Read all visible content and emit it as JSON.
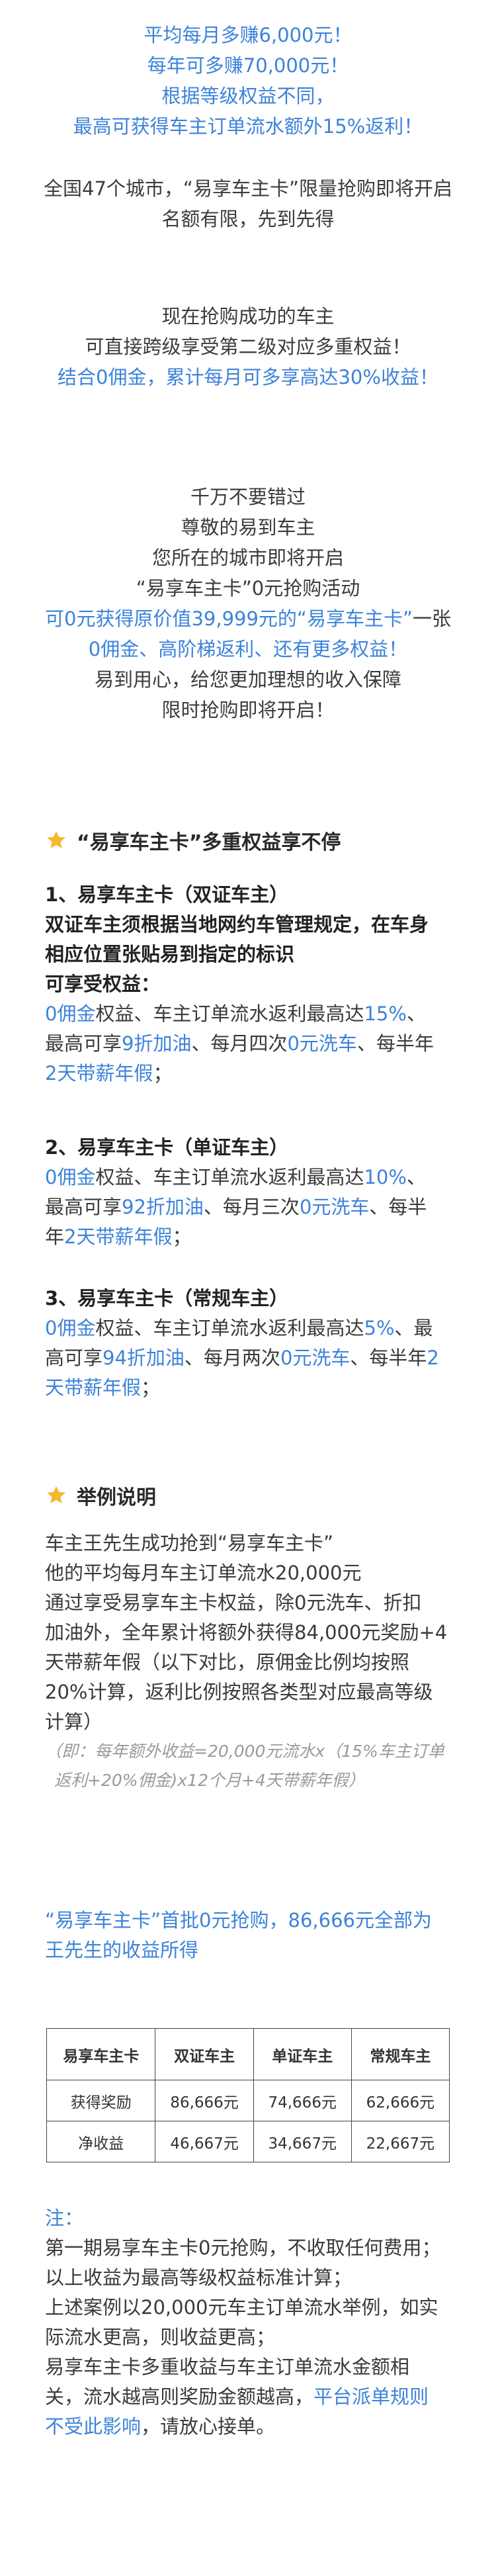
{
  "intro": {
    "lines": [
      "平均每月多赚6,000元！",
      "每年可多赚70,000元！",
      "根据等级权益不同，",
      "最高可获得车主订单流水额外15%返利！"
    ],
    "cities_line1": "全国47个城市，“易享车主卡”限量抢购即将开启",
    "cities_line2": "名额有限，先到先得"
  },
  "upgrade": {
    "line1": "现在抢购成功的车主",
    "line2": "可直接跨级享受第二级对应多重权益！",
    "line3": "结合0佣金，累计每月可多享高达30%收益！"
  },
  "invite": {
    "line1": "千万不要错过",
    "line2": "尊敬的易到车主",
    "line3": "您所在的城市即将开启",
    "line4": "“易享车主卡”0元抢购活动",
    "line5a": "可0元获得原价值39,999元的“易享车主卡”",
    "line5b": "一张",
    "line6": "0佣金、高阶梯返利、还有更多权益！",
    "line7": "易到用心，给您更加理想的收入保障",
    "line8": "限时抢购即将开启！"
  },
  "benefits": {
    "title": "“易享车主卡”多重权益享不停",
    "card1_title": "1、易享车主卡（双证车主）",
    "card1_rule1": "双证车主须根据当地网约车管理规定，在车身",
    "card1_rule2": "相应位置张贴易到指定的标识",
    "card1_enjoy": "可享受权益：",
    "card1_l1a": "0佣金",
    "card1_l1b": "权益、车主订单流水返利最高达",
    "card1_l1c": "15%",
    "card1_l1d": "、",
    "card1_l2a": "最高可享",
    "card1_l2b": "9折加油",
    "card1_l2c": "、每月四次",
    "card1_l2d": "0元洗车",
    "card1_l2e": "、每半年",
    "card1_l3a": "2天带薪年假",
    "card1_l3b": "；",
    "card2_title": "2、易享车主卡（单证车主）",
    "card2_l1a": "0佣金",
    "card2_l1b": "权益、车主订单流水返利最高达",
    "card2_l1c": "10%",
    "card2_l1d": "、",
    "card2_l2a": "最高可享",
    "card2_l2b": "92折加油",
    "card2_l2c": "、每月三次",
    "card2_l2d": "0元洗车",
    "card2_l2e": "、每半",
    "card2_l3a": "年",
    "card2_l3b": "2天带薪年假",
    "card2_l3c": "；",
    "card3_title": "3、易享车主卡（常规车主）",
    "card3_l1a": "0佣金",
    "card3_l1b": "权益、车主订单流水返利最高达",
    "card3_l1c": "5%",
    "card3_l1d": "、最",
    "card3_l2a": "高可享",
    "card3_l2b": "94折加油",
    "card3_l2c": "、每月两次",
    "card3_l2d": "0元洗车",
    "card3_l2e": "、每半年",
    "card3_l2f": "2",
    "card3_l3a": "天带薪年假",
    "card3_l3b": "；"
  },
  "example": {
    "title": "举例说明",
    "l1": "车主王先生成功抢到“易享车主卡”",
    "l2": "他的平均每月车主订单流水20,000元",
    "l3": "通过享受易享车主卡权益，除0元洗车、折扣",
    "l4": "加油外，全年累计将额外获得84,000元奖励+4",
    "l5": "天带薪年假（以下对比，原佣金比例均按照",
    "l6": "20%计算，返利比例按照各类型对应最高等级",
    "l7": "计算）",
    "formula1": "（即：每年额外收益=20,000元流水x（15%车主订单",
    "formula2": "返利+20%佣金)x12个月+4天带薪年假）",
    "summary1": "“易享车主卡”首批0元抢购，86,666元全部为",
    "summary2": "王先生的收益所得"
  },
  "table": {
    "headers": [
      "易享车主卡",
      "双证车主",
      "单证车主",
      "常规车主"
    ],
    "rows": [
      {
        "label": "获得奖励",
        "values": [
          "86,666元",
          "74,666元",
          "62,666元"
        ]
      },
      {
        "label": "净收益",
        "values": [
          "46,667元",
          "34,667元",
          "22,667元"
        ]
      }
    ]
  },
  "notes": {
    "title": "注：",
    "l1": "第一期易享车主卡0元抢购，不收取任何费用；",
    "l2": "以上收益为最高等级权益标准计算；",
    "l3": "上述案例以20,000元车主订单流水举例，如实",
    "l4": "际流水更高，则收益更高；",
    "l5": "易享车主卡多重收益与车主订单流水金额相",
    "l6a": "关，流水越高则奖励金额越高，",
    "l6b": "平台派单规则",
    "l7a": "不受此影响",
    "l7b": "，请放心接单。"
  },
  "colors": {
    "accent": "#3d83d9",
    "highlight_red": "#e0322c",
    "star": "#f5b82e"
  }
}
